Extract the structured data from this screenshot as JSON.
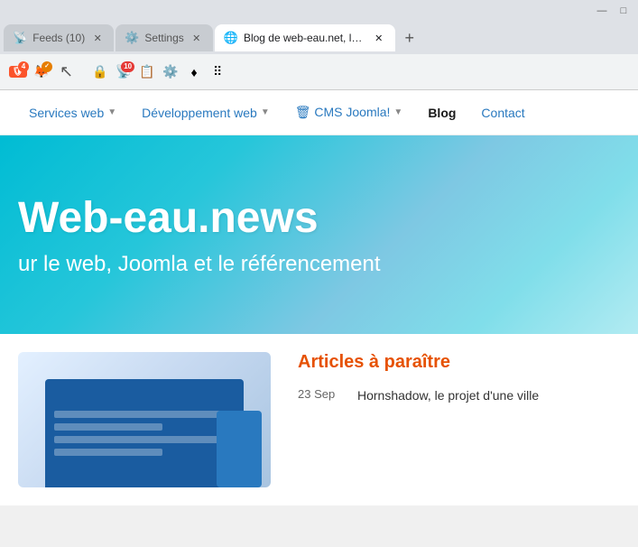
{
  "browser": {
    "tabs": [
      {
        "id": "feeds",
        "label": "Feeds (10)",
        "icon": "📡",
        "active": false
      },
      {
        "id": "settings",
        "label": "Settings",
        "icon": "⚙️",
        "active": false
      },
      {
        "id": "blog",
        "label": "Blog de web-eau.net, le...",
        "icon": "🌐",
        "active": true
      }
    ],
    "new_tab_label": "+",
    "window_controls": {
      "minimize": "—",
      "maximize": "□"
    },
    "extensions": [
      {
        "name": "brave-shield",
        "symbol": "🛡",
        "badge": "4",
        "badge_color": "#fb542b"
      },
      {
        "name": "metamask",
        "symbol": "🦊",
        "badge": "✓",
        "badge_color": "#e67e00"
      },
      {
        "name": "extension-red",
        "symbol": "🔒",
        "badge": ""
      },
      {
        "name": "rss-reader",
        "symbol": "📡",
        "badge": "10",
        "badge_color": "#e53935"
      },
      {
        "name": "extension-green",
        "symbol": "📋",
        "badge": ""
      },
      {
        "name": "extension-orange",
        "symbol": "⚙️",
        "badge": ""
      },
      {
        "name": "ethereum",
        "symbol": "♦",
        "badge": ""
      },
      {
        "name": "extension-dots",
        "symbol": "⠿",
        "badge": ""
      }
    ]
  },
  "site": {
    "nav": {
      "items": [
        {
          "label": "Services web",
          "has_dropdown": true,
          "active": false
        },
        {
          "label": "Développement web",
          "has_dropdown": true,
          "active": false
        },
        {
          "label": "🗑 CMS Joomla!",
          "has_dropdown": true,
          "active": false
        },
        {
          "label": "Blog",
          "has_dropdown": false,
          "active": true
        },
        {
          "label": "Contact",
          "has_dropdown": false,
          "active": false
        }
      ]
    },
    "hero": {
      "title": "Web-eau.news",
      "subtitle": "ur le web, Joomla et le référencement"
    },
    "articles_section": {
      "title": "Articles à paraître",
      "items": [
        {
          "date": "23 Sep",
          "title": "Hornshadow, le projet d'une ville"
        }
      ]
    }
  }
}
